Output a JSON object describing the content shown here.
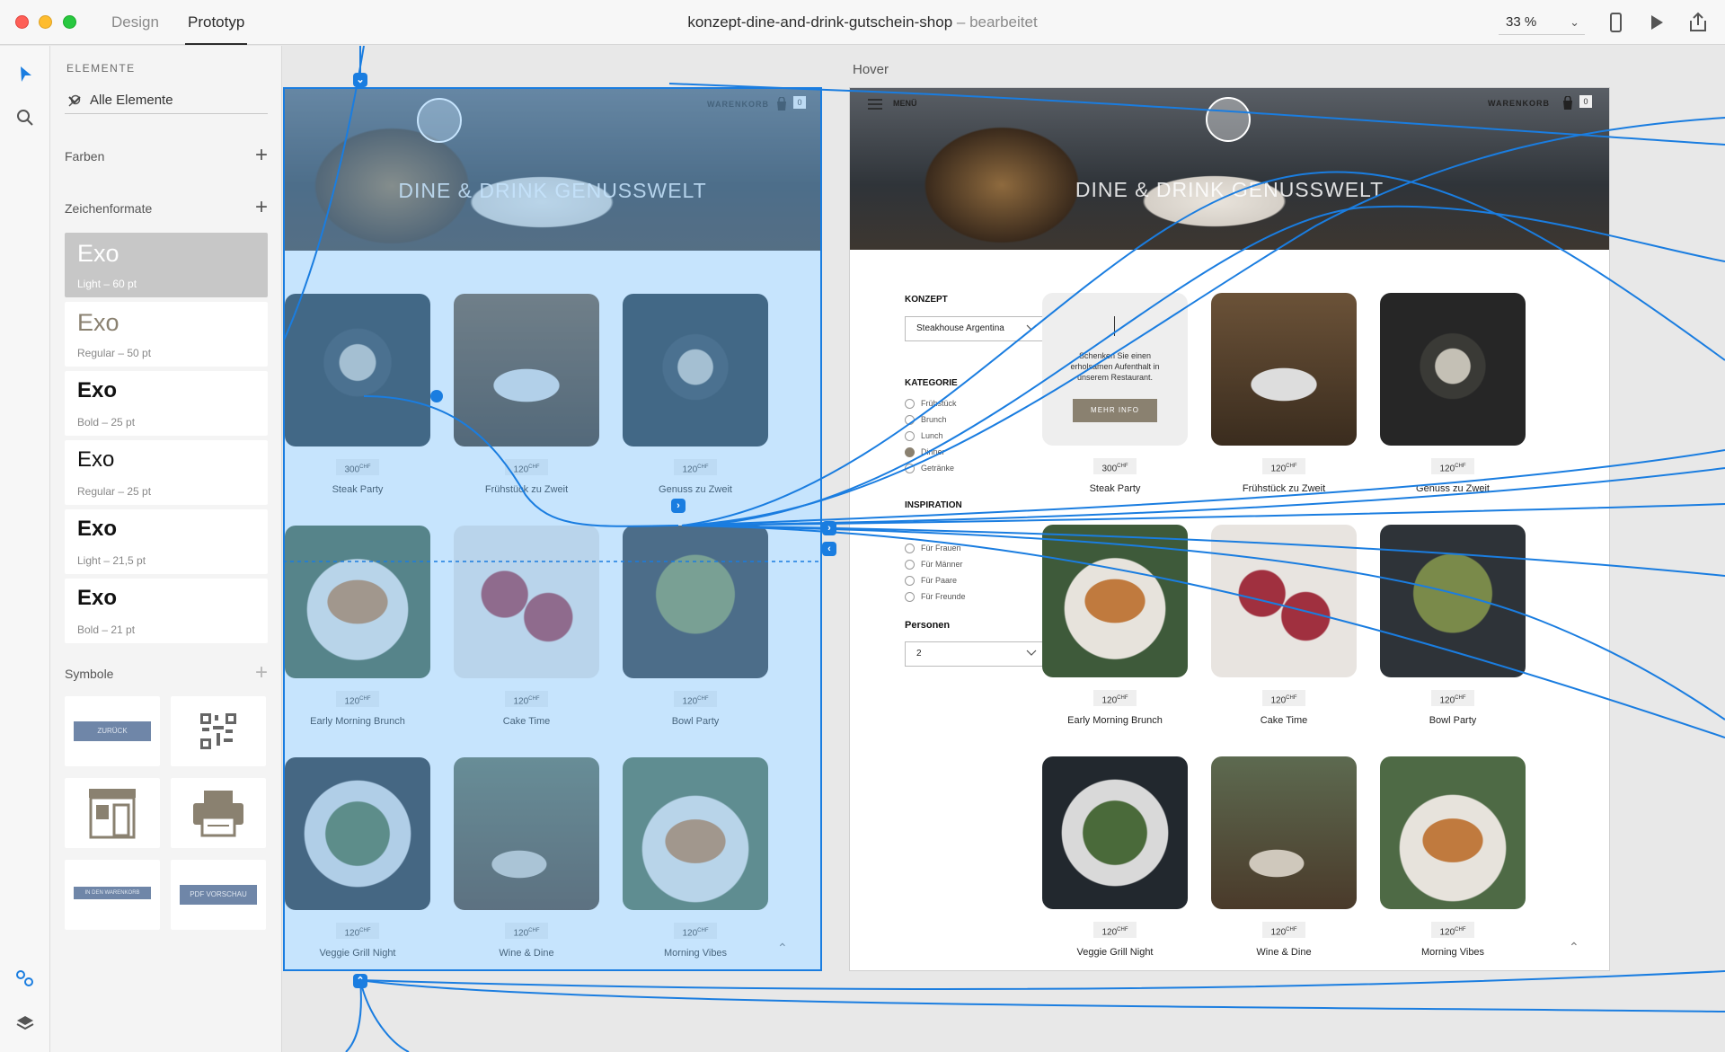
{
  "window": {
    "tabs": {
      "design": "Design",
      "prototype": "Prototyp"
    },
    "doc_title": "konzept-dine-and-drink-gutschein-shop",
    "doc_status": "– bearbeitet",
    "zoom": "33 %"
  },
  "panel": {
    "header": "ELEMENTE",
    "search_value": "Alle Elemente",
    "colors_label": "Farben",
    "char_styles_label": "Zeichenformate",
    "symbols_label": "Symbole",
    "char_styles": [
      {
        "font": "Exo",
        "desc": "Light – 60 pt"
      },
      {
        "font": "Exo",
        "desc": "Regular – 50 pt"
      },
      {
        "font": "Exo",
        "desc": "Bold – 25 pt"
      },
      {
        "font": "Exo",
        "desc": "Regular – 25 pt"
      },
      {
        "font": "Exo",
        "desc": "Light – 21,5 pt"
      },
      {
        "font": "Exo",
        "desc": "Bold – 21 pt"
      }
    ],
    "symbols": {
      "back": "ZURÜCK",
      "cart": "IN DEN WARENKORB",
      "pdf": "PDF VORSCHAU"
    }
  },
  "artboard_hover_label": "Hover",
  "shop": {
    "hero_title": "DINE & DRINK GENUSSWELT",
    "cart_label": "WARENKORB",
    "cart_count": "0",
    "menu_label": "MENÜ",
    "currency": "CHF",
    "promo_text": "Schenken Sie einen erholsamen Aufenthalt in unserem Restaurant.",
    "promo_button": "MEHR INFO",
    "filters": {
      "concept_label": "KONZEPT",
      "concept_value": "Steakhouse Argentina",
      "category_label": "KATEGORIE",
      "categories": [
        "Frühstück",
        "Brunch",
        "Lunch",
        "Dinner",
        "Getränke"
      ],
      "inspiration_label": "INSPIRATION",
      "inspirations": [
        "Für Frauen",
        "Für Männer",
        "Für Paare",
        "Für Freunde"
      ],
      "persons_label": "Personen",
      "persons_value": "2"
    },
    "products": [
      {
        "name": "Steak Party",
        "price": "300"
      },
      {
        "name": "Frühstück zu Zweit",
        "price": "120"
      },
      {
        "name": "Genuss zu Zweit",
        "price": "120"
      },
      {
        "name": "Early Morning Brunch",
        "price": "120"
      },
      {
        "name": "Cake Time",
        "price": "120"
      },
      {
        "name": "Bowl Party",
        "price": "120"
      },
      {
        "name": "Veggie Grill Night",
        "price": "120"
      },
      {
        "name": "Wine & Dine",
        "price": "120"
      },
      {
        "name": "Morning Vibes",
        "price": "120"
      }
    ]
  },
  "colors": {
    "accent": "#1a7de0",
    "brand": "#8a8170"
  }
}
